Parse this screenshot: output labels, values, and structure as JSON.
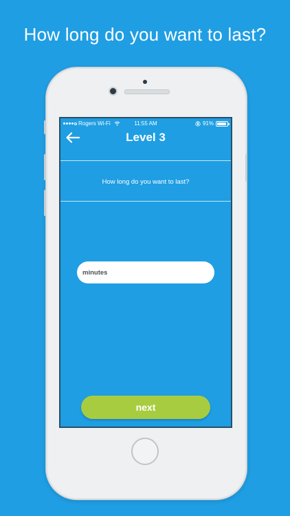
{
  "headline": "How long do you want to last?",
  "status_bar": {
    "carrier": "Rogers Wi-Fi",
    "time": "11:55 AM",
    "battery_text": "91%",
    "battery_level": 0.91
  },
  "nav": {
    "title": "Level 3",
    "back_icon": "arrow-left-icon"
  },
  "question": "How long do you want to last?",
  "duration_input": {
    "value": "",
    "placeholder": "minutes"
  },
  "next_button": {
    "label": "next"
  },
  "colors": {
    "background": "#1f9ee3",
    "screen": "#1f9ee3",
    "button": "#a8cc3f",
    "text": "#ffffff"
  }
}
